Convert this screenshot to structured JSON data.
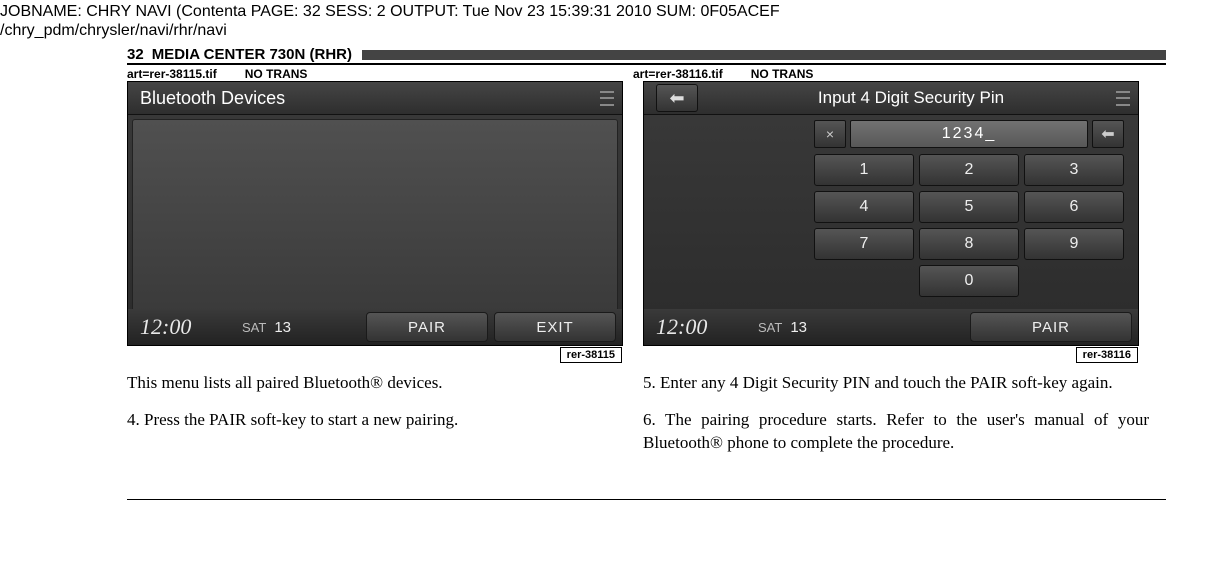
{
  "job_header": {
    "line1": "JOBNAME: CHRY NAVI (Contenta    PAGE: 32  SESS: 2  OUTPUT: Tue Nov 23 15:39:31 2010  SUM: 0F05ACEF",
    "line2": "/chry_pdm/chrysler/navi/rhr/navi"
  },
  "page_header": {
    "page_num": "32",
    "title": "MEDIA CENTER 730N (RHR)"
  },
  "art_labels": {
    "left_art": "art=rer-38115.tif",
    "left_trans": "NO TRANS",
    "right_art": "art=rer-38116.tif",
    "right_trans": "NO TRANS"
  },
  "screen1": {
    "title": "Bluetooth Devices",
    "clock": "12:00",
    "sat_label": "SAT",
    "sat_num": "13",
    "pair": "PAIR",
    "exit": "EXIT",
    "img_id": "rer-38115"
  },
  "screen2": {
    "title": "Input 4 Digit Security Pin",
    "pin_value": "1234_",
    "keys": [
      "1",
      "2",
      "3",
      "4",
      "5",
      "6",
      "7",
      "8",
      "9",
      "0"
    ],
    "clock": "12:00",
    "sat_label": "SAT",
    "sat_num": "13",
    "pair": "PAIR",
    "img_id": "rer-38116"
  },
  "captions": {
    "left_p1": "This menu lists all paired Bluetooth® devices.",
    "left_p2": "4.  Press the PAIR soft-key to start a new pairing.",
    "right_p1": "5. Enter any 4 Digit Security PIN and touch the PAIR soft-key again.",
    "right_p2": "6. The pairing procedure starts. Refer to the user's manual of your Bluetooth® phone to complete the procedure."
  }
}
